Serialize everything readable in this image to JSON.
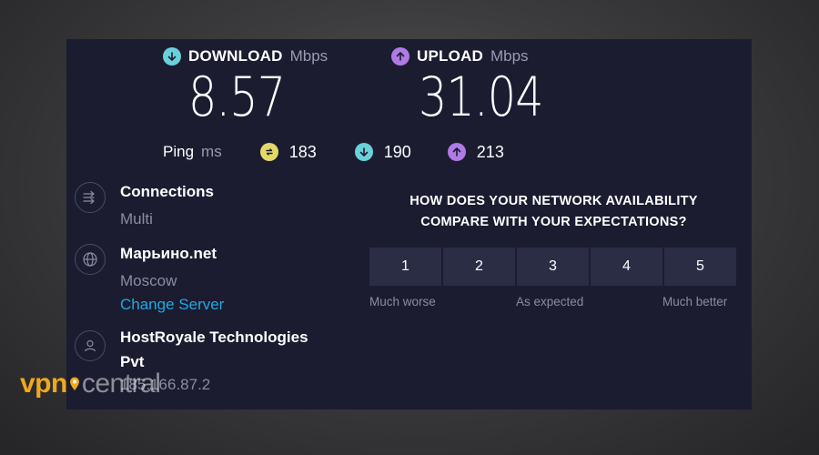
{
  "download": {
    "label": "DOWNLOAD",
    "unit": "Mbps",
    "value": "8.57",
    "icon": "arrow-down-circle-icon"
  },
  "upload": {
    "label": "UPLOAD",
    "unit": "Mbps",
    "value": "31.04",
    "icon": "arrow-up-circle-icon"
  },
  "ping": {
    "label": "Ping",
    "unit": "ms",
    "idle": "183",
    "download": "190",
    "upload": "213"
  },
  "connections": {
    "title": "Connections",
    "value": "Multi"
  },
  "server": {
    "name": "Марьино.net",
    "location": "Moscow",
    "change_label": "Change Server"
  },
  "provider": {
    "name_line1": "HostRoyale Technologies",
    "name_line2": "Pvt",
    "ip": "185.166.87.2"
  },
  "survey": {
    "question_line1": "HOW DOES YOUR NETWORK AVAILABILITY",
    "question_line2": "COMPARE WITH YOUR EXPECTATIONS?",
    "options": [
      "1",
      "2",
      "3",
      "4",
      "5"
    ],
    "low_label": "Much worse",
    "mid_label": "As expected",
    "high_label": "Much better"
  },
  "watermark": {
    "brand_part1": "vpn",
    "brand_part2": "central"
  },
  "colors": {
    "panel": "#1b1c30",
    "download_accent": "#6ad1d9",
    "upload_accent": "#b07ae6",
    "ping_accent": "#e3d96a",
    "link": "#21a9e1",
    "watermark_orange": "#f0a81e"
  }
}
